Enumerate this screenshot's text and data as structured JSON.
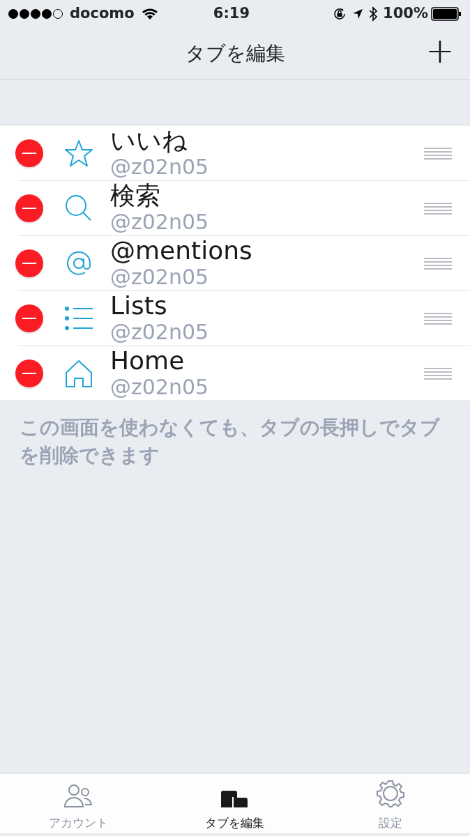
{
  "status_bar": {
    "carrier": "docomo",
    "time": "6:19",
    "battery": "100%"
  },
  "nav_bar": {
    "title": "タブを編集",
    "add_button": "+"
  },
  "tabs": [
    {
      "name": "いいね",
      "account": "@z02n05"
    },
    {
      "name": "検索",
      "account": "@z02n05"
    },
    {
      "name": "@mentions",
      "account": "@z02n05"
    },
    {
      "name": "Lists",
      "account": "@z02n05"
    },
    {
      "name": "Home",
      "account": "@z02n05"
    }
  ],
  "hint": "この画面を使わなくても、タブの長押しでタブを削除できます",
  "tab_bar": [
    {
      "label": "アカウント",
      "selected": false
    },
    {
      "label": "タブを編集",
      "selected": true
    },
    {
      "label": "設定",
      "selected": false
    }
  ]
}
